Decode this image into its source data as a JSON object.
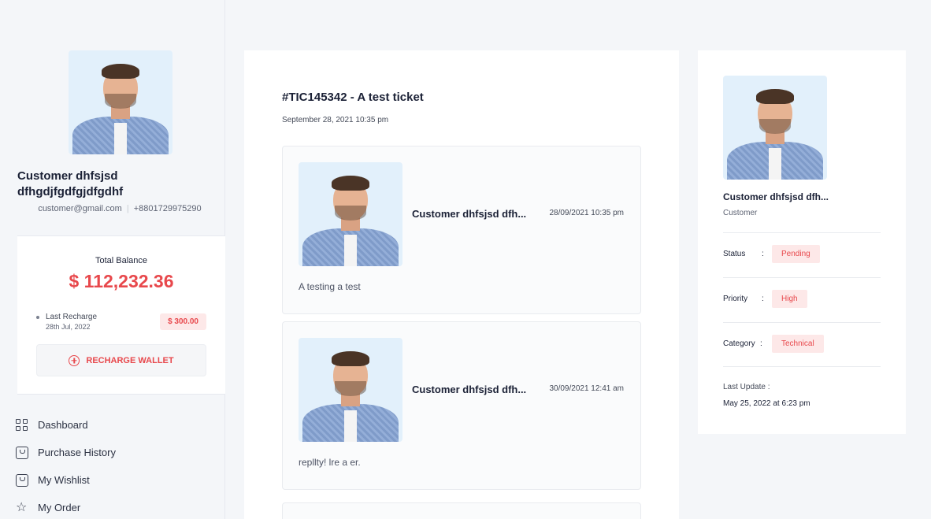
{
  "sidebar": {
    "profile": {
      "name": "Customer dhfsjsd dfhgdjfgdfgjdfgdhf",
      "email": "customer@gmail.com",
      "phone": "+8801729975290"
    },
    "wallet": {
      "balance_label": "Total Balance",
      "balance": "$ 112,232.36",
      "last_recharge_label": "Last Recharge",
      "last_recharge_date": "28th Jul, 2022",
      "last_recharge_amount": "$ 300.00",
      "recharge_button": "RECHARGE WALLET"
    },
    "nav": [
      {
        "label": "Dashboard",
        "icon": "grid-icon"
      },
      {
        "label": "Purchase History",
        "icon": "bag-icon"
      },
      {
        "label": "My Wishlist",
        "icon": "bag-icon"
      },
      {
        "label": "My Order",
        "icon": "star-icon"
      }
    ]
  },
  "ticket": {
    "title": "#TIC145342 - A test ticket",
    "date": "September 28, 2021 10:35 pm",
    "messages": [
      {
        "author": "Customer dhfsjsd dfh...",
        "time": "28/09/2021 10:35 pm",
        "text": "A testing a test"
      },
      {
        "author": "Customer dhfsjsd dfh...",
        "time": "30/09/2021 12:41 am",
        "text": "repllty! lre a er."
      }
    ]
  },
  "details": {
    "name": "Customer dhfsjsd dfh...",
    "role": "Customer",
    "status_label": "Status",
    "status": "Pending",
    "priority_label": "Priority",
    "priority": "High",
    "category_label": "Category",
    "category": "Technical",
    "colon": ":",
    "last_update_label": "Last Update :",
    "last_update": "May 25, 2022 at 6:23 pm"
  },
  "colors": {
    "accent": "#e8484c",
    "badge_bg": "#fde8e8",
    "page_bg": "#f4f6f9"
  }
}
